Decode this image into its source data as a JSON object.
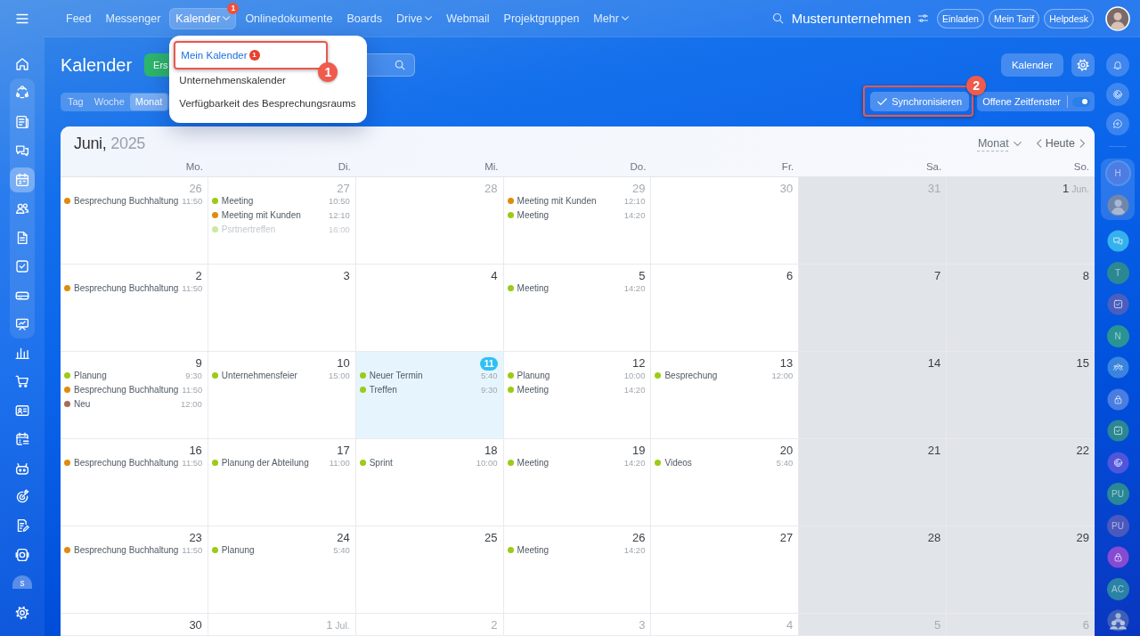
{
  "left_sidebar": {
    "top": [
      {
        "kind": "home",
        "selected": false
      }
    ],
    "group": [
      {
        "kind": "flow",
        "selected": false
      },
      {
        "kind": "news",
        "selected": false
      },
      {
        "kind": "chat",
        "selected": false
      },
      {
        "kind": "calendar",
        "selected": true
      },
      {
        "kind": "contacts",
        "selected": false
      },
      {
        "kind": "document",
        "selected": false
      },
      {
        "kind": "tasks",
        "selected": false
      },
      {
        "kind": "drive",
        "selected": false
      },
      {
        "kind": "board",
        "selected": false
      }
    ],
    "bottom": [
      {
        "kind": "chart",
        "selected": false
      },
      {
        "kind": "cart",
        "selected": false
      },
      {
        "kind": "card",
        "selected": false
      },
      {
        "kind": "schedule",
        "selected": false
      },
      {
        "kind": "robot",
        "selected": false
      },
      {
        "kind": "target",
        "selected": false
      },
      {
        "kind": "edit",
        "selected": false
      },
      {
        "kind": "tile",
        "selected": false
      }
    ],
    "user_initial": "s"
  },
  "top_nav": {
    "items": [
      {
        "label": "Feed",
        "selected": false,
        "has_menu": false
      },
      {
        "label": "Messenger",
        "selected": false,
        "has_menu": false
      },
      {
        "label": "Kalender",
        "selected": true,
        "has_menu": true,
        "badge": "1"
      },
      {
        "label": "Onlinedokumente",
        "selected": false,
        "has_menu": false
      },
      {
        "label": "Boards",
        "selected": false,
        "has_menu": false
      },
      {
        "label": "Drive",
        "selected": false,
        "has_menu": true
      },
      {
        "label": "Webmail",
        "selected": false,
        "has_menu": false
      },
      {
        "label": "Projektgruppen",
        "selected": false,
        "has_menu": false
      },
      {
        "label": "Mehr",
        "selected": false,
        "has_menu": true
      }
    ]
  },
  "calendar_menu": {
    "items": [
      {
        "label": "Mein Kalender",
        "selected": true,
        "badge": "1",
        "callout": "1"
      },
      {
        "label": "Unternehmenskalender",
        "selected": false
      },
      {
        "label": "Verfügbarkeit des Besprechungsraums",
        "selected": false
      }
    ]
  },
  "company": {
    "name": "Musterunternehmen"
  },
  "header_links": [
    "Einladen",
    "Mein Tarif",
    "Helpdesk"
  ],
  "page": {
    "title": "Kalender",
    "create_button": "Ers",
    "calendar_button": "Kalender"
  },
  "views": [
    {
      "label": "Tag",
      "selected": false
    },
    {
      "label": "Woche",
      "selected": false
    },
    {
      "label": "Monat",
      "selected": true
    }
  ],
  "sync_button": {
    "label": "Synchronisieren",
    "callout": "2"
  },
  "open_slots": {
    "label": "Offene Zeitfenster",
    "on": true
  },
  "calendar": {
    "month": "Juni,",
    "year": "2025",
    "view_select": "Monat",
    "today_button": "Heute",
    "weekdays": [
      {
        "label": "Mo.",
        "weekend": false
      },
      {
        "label": "Di.",
        "weekend": false
      },
      {
        "label": "Mi.",
        "weekend": false
      },
      {
        "label": "Do.",
        "weekend": false
      },
      {
        "label": "Fr.",
        "weekend": false
      },
      {
        "label": "Sa.",
        "weekend": true
      },
      {
        "label": "So.",
        "weekend": true
      }
    ],
    "weeks": [
      [
        {
          "day": "26",
          "muted": true,
          "today": false,
          "events": [
            {
              "title": "Besprechung Buchhaltung",
              "time": "11:50",
              "color": "#e08b0e",
              "faded": false
            }
          ]
        },
        {
          "day": "27",
          "muted": true,
          "today": false,
          "events": [
            {
              "title": "Meeting",
              "time": "10:50",
              "color": "#9bcb16",
              "faded": false
            },
            {
              "title": "Meeting mit Kunden",
              "time": "12:10",
              "color": "#e08b0e",
              "faded": false
            },
            {
              "title": "Psrtnertreffen",
              "time": "16:00",
              "color": "#cde7a4",
              "faded": true
            }
          ]
        },
        {
          "day": "28",
          "muted": true,
          "today": false
        },
        {
          "day": "29",
          "muted": true,
          "today": false,
          "events": [
            {
              "title": "Meeting mit Kunden",
              "time": "12:10",
              "color": "#e08b0e",
              "faded": false
            },
            {
              "title": "Meeting",
              "time": "14:20",
              "color": "#9bcb16",
              "faded": false
            }
          ]
        },
        {
          "day": "30",
          "muted": true,
          "today": false
        },
        {
          "day": "31",
          "muted": true,
          "today": false
        },
        {
          "day": "1",
          "suffix": "Jun.",
          "muted": false,
          "today": false
        }
      ],
      [
        {
          "day": "2",
          "muted": false,
          "today": false,
          "events": [
            {
              "title": "Besprechung Buchhaltung",
              "time": "11:50",
              "color": "#e08b0e",
              "faded": false
            }
          ]
        },
        {
          "day": "3",
          "muted": false,
          "today": false
        },
        {
          "day": "4",
          "muted": false,
          "today": false
        },
        {
          "day": "5",
          "muted": false,
          "today": false,
          "events": [
            {
              "title": "Meeting",
              "time": "14:20",
              "color": "#9bcb16",
              "faded": false
            }
          ]
        },
        {
          "day": "6",
          "muted": false,
          "today": false
        },
        {
          "day": "7",
          "muted": false,
          "today": false
        },
        {
          "day": "8",
          "muted": false,
          "today": false
        }
      ],
      [
        {
          "day": "9",
          "muted": false,
          "today": false,
          "events": [
            {
              "title": "Planung",
              "time": "9:30",
              "color": "#9bcb16",
              "faded": false
            },
            {
              "title": "Besprechung Buchhaltung",
              "time": "11:50",
              "color": "#e08b0e",
              "faded": false
            },
            {
              "title": "Neu",
              "time": "12:00",
              "color": "#a86b5a",
              "faded": false
            }
          ]
        },
        {
          "day": "10",
          "muted": false,
          "today": false,
          "events": [
            {
              "title": "Unternehmensfeier",
              "time": "15:00",
              "color": "#9bcb16",
              "faded": false
            }
          ]
        },
        {
          "day": "11",
          "muted": false,
          "today": true,
          "events": [
            {
              "title": "Neuer Termin",
              "time": "5:40",
              "color": "#9bcb16",
              "faded": false
            },
            {
              "title": "Treffen",
              "time": "9:30",
              "color": "#9bcb16",
              "faded": false
            }
          ]
        },
        {
          "day": "12",
          "muted": false,
          "today": false,
          "events": [
            {
              "title": "Planung",
              "time": "10:00",
              "color": "#9bcb16",
              "faded": false
            },
            {
              "title": "Meeting",
              "time": "14:20",
              "color": "#9bcb16",
              "faded": false
            }
          ]
        },
        {
          "day": "13",
          "muted": false,
          "today": false,
          "events": [
            {
              "title": "Besprechung",
              "time": "12:00",
              "color": "#9bcb16",
              "faded": false
            }
          ]
        },
        {
          "day": "14",
          "muted": false,
          "today": false
        },
        {
          "day": "15",
          "muted": false,
          "today": false
        }
      ],
      [
        {
          "day": "16",
          "muted": false,
          "today": false,
          "events": [
            {
              "title": "Besprechung Buchhaltung",
              "time": "11:50",
              "color": "#e08b0e",
              "faded": false
            }
          ]
        },
        {
          "day": "17",
          "muted": false,
          "today": false,
          "events": [
            {
              "title": "Planung der Abteilung",
              "time": "11:00",
              "color": "#9bcb16",
              "faded": false
            }
          ]
        },
        {
          "day": "18",
          "muted": false,
          "today": false,
          "events": [
            {
              "title": "Sprint",
              "time": "10:00",
              "color": "#9bcb16",
              "faded": false
            }
          ]
        },
        {
          "day": "19",
          "muted": false,
          "today": false,
          "events": [
            {
              "title": "Meeting",
              "time": "14:20",
              "color": "#9bcb16",
              "faded": false
            }
          ]
        },
        {
          "day": "20",
          "muted": false,
          "today": false,
          "events": [
            {
              "title": "Videos",
              "time": "5:40",
              "color": "#9bcb16",
              "faded": false
            }
          ]
        },
        {
          "day": "21",
          "muted": false,
          "today": false
        },
        {
          "day": "22",
          "muted": false,
          "today": false
        }
      ],
      [
        {
          "day": "23",
          "muted": false,
          "today": false,
          "events": [
            {
              "title": "Besprechung Buchhaltung",
              "time": "11:50",
              "color": "#e08b0e",
              "faded": false
            }
          ]
        },
        {
          "day": "24",
          "muted": false,
          "today": false,
          "events": [
            {
              "title": "Planung",
              "time": "5:40",
              "color": "#9bcb16",
              "faded": false
            }
          ]
        },
        {
          "day": "25",
          "muted": false,
          "today": false
        },
        {
          "day": "26",
          "muted": false,
          "today": false,
          "events": [
            {
              "title": "Meeting",
              "time": "14:20",
              "color": "#9bcb16",
              "faded": false
            }
          ]
        },
        {
          "day": "27",
          "muted": false,
          "today": false
        },
        {
          "day": "28",
          "muted": false,
          "today": false
        },
        {
          "day": "29",
          "muted": false,
          "today": false
        }
      ],
      [
        {
          "day": "30",
          "muted": false,
          "today": false
        },
        {
          "day": "1",
          "suffix": "Jul.",
          "muted": true,
          "today": false
        },
        {
          "day": "2",
          "muted": true,
          "today": false
        },
        {
          "day": "3",
          "muted": true,
          "today": false
        },
        {
          "day": "4",
          "muted": true,
          "today": false
        },
        {
          "day": "5",
          "muted": true,
          "today": false
        },
        {
          "day": "6",
          "muted": true,
          "today": false
        }
      ]
    ]
  },
  "right_sidebar": {
    "tools": [
      {
        "kind": "bell"
      },
      {
        "kind": "spiral"
      },
      {
        "kind": "message"
      }
    ],
    "pinned": [
      {
        "kind": "initials",
        "label": "H",
        "color": "#4d7de2"
      },
      {
        "kind": "photo"
      }
    ],
    "chats": [
      {
        "kind": "chat",
        "color": "#35b2ec"
      },
      {
        "kind": "initials",
        "label": "T",
        "color": "#2b8893"
      },
      {
        "kind": "tasks",
        "color": "#4a5ebf"
      },
      {
        "kind": "initials",
        "label": "N",
        "color": "#2a9494"
      },
      {
        "kind": "group",
        "color": "#3a84e0"
      },
      {
        "kind": "lock",
        "color": "#497de2"
      },
      {
        "kind": "tasks",
        "color": "#2b8791"
      },
      {
        "kind": "spiral",
        "color": "#4f56dc"
      },
      {
        "kind": "initials",
        "label": "PU",
        "color": "#2a8795"
      },
      {
        "kind": "initials",
        "label": "PU",
        "color": "#4a59bd"
      },
      {
        "kind": "lock",
        "color": "#864bd2"
      },
      {
        "kind": "initials",
        "label": "AC",
        "color": "#2a82a6"
      },
      {
        "kind": "group_photo"
      }
    ]
  }
}
